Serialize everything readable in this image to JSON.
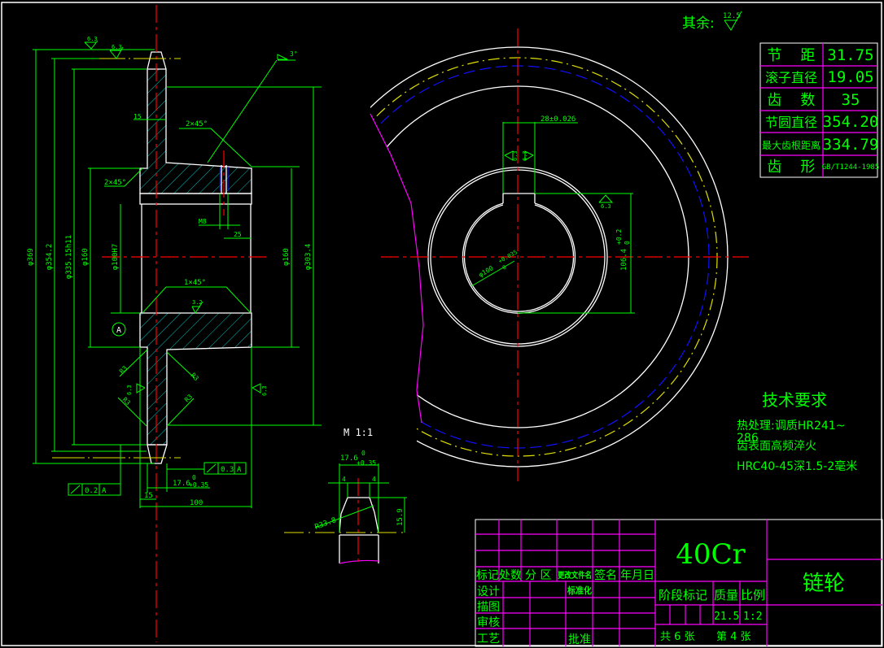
{
  "colors": {
    "dimension": "#00ff00",
    "outline": "#ffffff",
    "frame_table": "#ff00ff",
    "centerline": "#ff0000",
    "pitch_line": "#e0e000",
    "root_line": "#1010ff",
    "hatch": "#00c0c0",
    "background": "#000000"
  },
  "roughness_other": {
    "label": "其余:",
    "value": "12.5"
  },
  "param_table": {
    "rows": [
      {
        "label": "节    距",
        "value": "31.75"
      },
      {
        "label": "滚子直径",
        "value": "19.05"
      },
      {
        "label": "齿    数",
        "value": "35"
      },
      {
        "label": "节圆直径",
        "value": "354.20"
      },
      {
        "label": "最大齿根距离",
        "value": "334.79"
      },
      {
        "label": "齿    形",
        "value": "GB/T1244-1985"
      }
    ]
  },
  "section_view": {
    "dia_labels": [
      "φ369",
      "φ354.2",
      "φ335.15h11",
      "φ160",
      "φ100H7",
      "φ160",
      "φ303.4"
    ],
    "roughness": [
      "6.3",
      "6.3",
      "3.2",
      "6.3",
      "6.3"
    ],
    "taper": "3°",
    "web_width": "15",
    "chamfer_top": "2×45°",
    "chamfer_left": "2×45°",
    "chamfer_bore": "1×45°",
    "thread": "M8",
    "thread_dist": "25",
    "datum": "A",
    "radii": [
      "R3",
      "R3",
      "R3",
      "R3"
    ],
    "runout_1": {
      "tol": "0.2",
      "datum": "A"
    },
    "runout_2": {
      "tol": "0.3",
      "datum": "A"
    },
    "tooth_width": {
      "value": "17.6",
      "upper": "0",
      "lower": "+0.35"
    },
    "web_width_bottom": "15",
    "hub_length": "100"
  },
  "detail_view": {
    "title": "M 1:1",
    "width": {
      "value": "17.6",
      "upper": "0",
      "lower": "+0.35"
    },
    "chamfer_a": "4",
    "chamfer_b": "4",
    "radius": "R33.8",
    "height": "15.9"
  },
  "front_view": {
    "keyway_width": "28±0.026",
    "keyway_rough_1": "6.3",
    "keyway_rough_2": "6.3",
    "keyway_rough_3": "6.3",
    "keyway_depth": {
      "value": "106.4",
      "upper": "+0.2",
      "lower": "0"
    },
    "bore": {
      "value": "φ100",
      "upper": "+0.035",
      "lower": "0"
    }
  },
  "tech_req": {
    "title": "技术要求",
    "lines": [
      "热处理:调质HR241~",
      "286",
      "齿表面高频淬火",
      "HRC40-45深1.5-2毫米"
    ]
  },
  "title_block": {
    "material": "40Cr",
    "part_name": "链轮",
    "rev_headers": [
      "标记",
      "处数",
      "分 区",
      "更改文件名",
      "签名",
      "年月日"
    ],
    "roles": [
      "设计",
      "描图",
      "审核",
      "工艺"
    ],
    "standardize": "标准化",
    "approve": "批准",
    "stage_label": "阶段标记",
    "mass_label": "质量",
    "scale_label": "比例",
    "mass": "21.5",
    "scale": "1:2",
    "sheets_total": "共 6 张",
    "sheet_no": "第 4 张"
  }
}
